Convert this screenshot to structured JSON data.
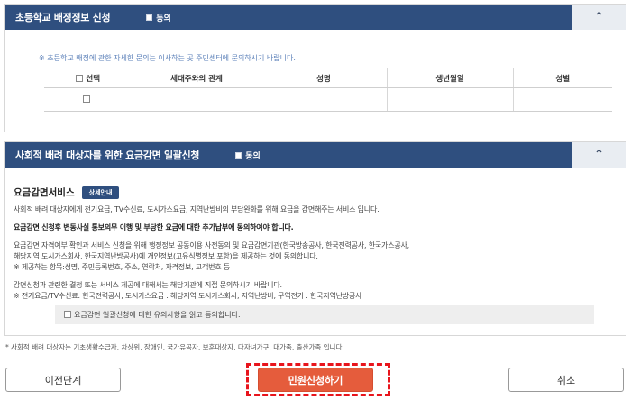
{
  "panel1": {
    "title": "초등학교 배정정보 신청",
    "agree_label": "동의",
    "note": "※ 초등학교 배정에 관한 자세한 문의는 이사하는 곳 주민센터에 문의하시기 바랍니다.",
    "columns": [
      "선택",
      "세대주와의 관계",
      "성명",
      "생년월일",
      "성별"
    ]
  },
  "panel2": {
    "title": "사회적 배려 대상자를 위한 요금감면 일괄신청",
    "agree_label": "동의",
    "service_title": "요금감면서비스",
    "detail_button": "상세안내",
    "lines": [
      "사회적 배려 대상자에게 전기요금, TV수신료, 도시가스요금, 지역난방비의 부담완화를 위해 요금을 감면해주는 서비스 입니다.",
      "요금감면 신청후 변동사실 통보의무 이행 및 부당한 요금에 대한 추가납부에 동의하여야 합니다.",
      "요금감면 자격여부 확인과 서비스 신청을 위해 행정정보 공동이용 사전동의 및 요금감면기관(한국방송공사, 한국전력공사, 한국가스공사,",
      "해당지역 도시가스회사, 한국지역난방공사)에 개인정보(고유식별정보 포함)을 제공하는 것에 동의합니다.",
      "※ 제공하는 항목:성명, 주민등록번호, 주소, 연락처, 자격정보, 고객번호 등",
      "감면신청과 관련한 결정 또는 서비스 제공에 대해서는 해당기관에 직접 문의하시기 바랍니다.",
      "※ 전기요금/TV수신료: 한국전력공사, 도시가스요금 : 해당지역 도시가스회사, 지역난방비, 구역전기 : 한국지역난방공사"
    ],
    "agreement_text": "요금감면 일괄신청에 대한 유의사항을 읽고 동의합니다."
  },
  "footnote": "* 사회적 배려 대상자는 기초생활수급자, 차상위, 장애인, 국가유공자, 보훈대상자, 다자녀가구, 대가족, 출산가족 입니다.",
  "buttons": {
    "prev": "이전단계",
    "apply": "민원신청하기",
    "cancel": "취소"
  },
  "icons": {
    "collapse": "chevron-up-icon",
    "checkbox": "checkbox-icon"
  },
  "colors": {
    "header_bg": "#2f4f7f",
    "apply_bg": "#e55c3c",
    "highlight_dash": "#e8141c"
  }
}
